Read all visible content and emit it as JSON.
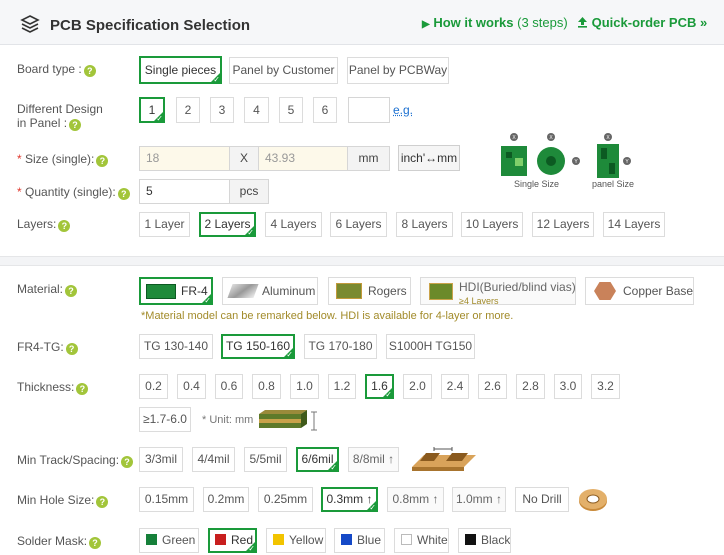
{
  "header": {
    "title": "PCB Specification Selection",
    "how_it_works": "How it works",
    "steps": "(3 steps)",
    "quick_order": "Quick-order PCB »"
  },
  "board_type": {
    "label": "Board type :",
    "options": [
      "Single pieces",
      "Panel by Customer",
      "Panel by PCBWay"
    ],
    "selected": "Single pieces"
  },
  "different_design": {
    "label_line1": "Different Design",
    "label_line2": "in Panel :",
    "options": [
      "1",
      "2",
      "3",
      "4",
      "5",
      "6"
    ],
    "selected": "1",
    "custom_value": "",
    "eg_link": "e.g."
  },
  "size": {
    "label": "Size (single):",
    "width": "18",
    "x": "X",
    "height": "43.93",
    "unit": "mm",
    "convert_button": "inch'↔mm",
    "caption_single": "Single Size",
    "caption_panel": "panel Size"
  },
  "quantity": {
    "label": "Quantity (single):",
    "value": "5",
    "unit": "pcs"
  },
  "layers": {
    "label": "Layers:",
    "options": [
      "1 Layer",
      "2 Layers",
      "4 Layers",
      "6 Layers",
      "8 Layers",
      "10 Layers",
      "12 Layers",
      "14 Layers"
    ],
    "selected": "2 Layers"
  },
  "material": {
    "label": "Material:",
    "options": [
      "FR-4",
      "Aluminum",
      "Rogers",
      "HDI(Buried/blind vias)",
      "Copper Base"
    ],
    "hdi_sub": "≥4 Layers",
    "selected": "FR-4",
    "note": "*Material model can be remarked below. HDI is available for 4-layer or more."
  },
  "fr4_tg": {
    "label": "FR4-TG:",
    "options": [
      "TG 130-140",
      "TG 150-160",
      "TG 170-180",
      "S1000H TG150"
    ],
    "selected": "TG 150-160"
  },
  "thickness": {
    "label": "Thickness:",
    "options": [
      "0.2",
      "0.4",
      "0.6",
      "0.8",
      "1.0",
      "1.2",
      "1.6",
      "2.0",
      "2.4",
      "2.6",
      "2.8",
      "3.0",
      "3.2",
      "≥1.7-6.0"
    ],
    "selected": "1.6",
    "unit_note": "* Unit: mm"
  },
  "track": {
    "label": "Min Track/Spacing:",
    "options": [
      "3/3mil",
      "4/4mil",
      "5/5mil",
      "6/6mil",
      "8/8mil ↑"
    ],
    "selected": "6/6mil"
  },
  "hole": {
    "label": "Min Hole Size:",
    "options": [
      "0.15mm",
      "0.2mm",
      "0.25mm",
      "0.3mm ↑",
      "0.8mm ↑",
      "1.0mm ↑",
      "No Drill"
    ],
    "selected": "0.3mm ↑"
  },
  "solder_mask": {
    "label": "Solder Mask:",
    "options": [
      "Green",
      "Red",
      "Yellow",
      "Blue",
      "White",
      "Black"
    ],
    "selected": "Red"
  },
  "colors": {
    "accent": "#1a9a3a",
    "required": "#e03a2f",
    "help": "#a2c53a",
    "mask_green": "#16803a",
    "mask_red": "#c81e1e",
    "mask_yellow": "#f2c400",
    "mask_blue": "#1549c7",
    "mask_white": "#ffffff",
    "mask_black": "#111111"
  }
}
